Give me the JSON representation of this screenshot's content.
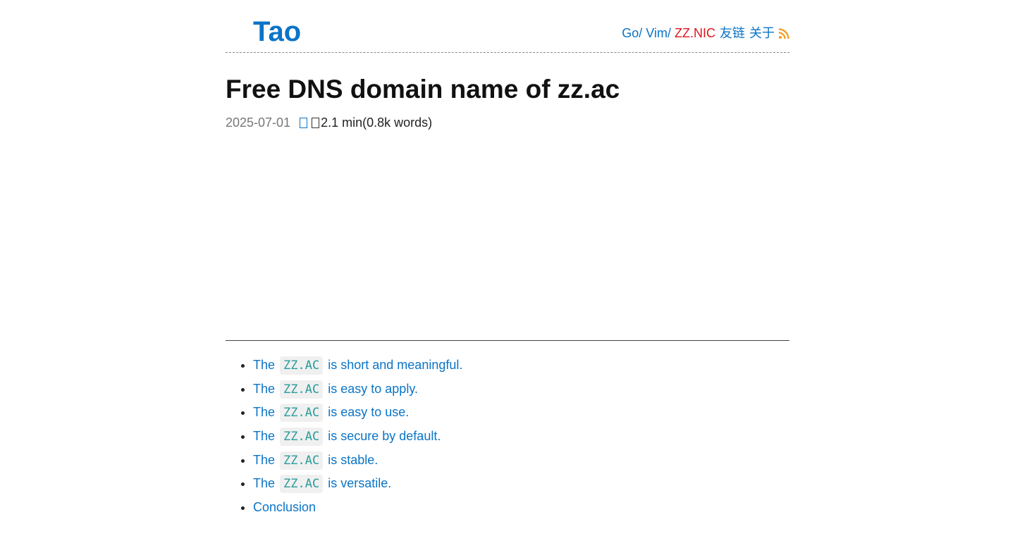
{
  "header": {
    "site_title": "Tao",
    "nav": {
      "go": "Go",
      "go_sep": "/",
      "vim": "Vim",
      "vim_sep": "/",
      "zznic": "ZZ.NIC",
      "links": "友链",
      "about": "关于",
      "rss_icon": "rss-icon"
    }
  },
  "post": {
    "title": "Free DNS domain name of zz.ac",
    "date": "2025-07-01",
    "reading": "2.1 min(0.8k words)"
  },
  "toc": [
    {
      "prefix": "The",
      "code": "ZZ.AC",
      "suffix": "is short and meaningful."
    },
    {
      "prefix": "The",
      "code": "ZZ.AC",
      "suffix": "is easy to apply."
    },
    {
      "prefix": "The",
      "code": "ZZ.AC",
      "suffix": "is easy to use."
    },
    {
      "prefix": "The",
      "code": "ZZ.AC",
      "suffix": "is secure by default."
    },
    {
      "prefix": "The",
      "code": "ZZ.AC",
      "suffix": "is stable."
    },
    {
      "prefix": "The",
      "code": "ZZ.AC",
      "suffix": "is versatile."
    },
    {
      "text": "Conclusion"
    }
  ],
  "colors": {
    "link": "#0a74c7",
    "nic": "#e0151d",
    "code": "#2a9c9c",
    "rss": "#f29a16"
  }
}
